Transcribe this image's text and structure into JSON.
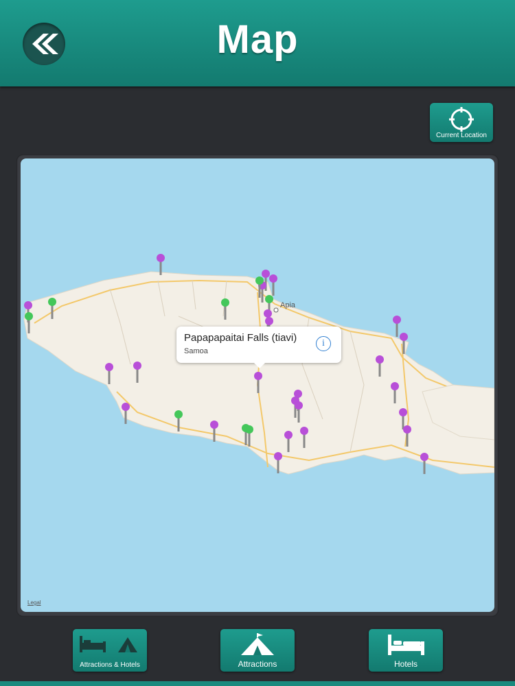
{
  "header": {
    "title": "Map",
    "back_icon": "double-chevron-left-icon"
  },
  "current_location": {
    "label": "Current Location",
    "icon": "crosshair-icon"
  },
  "map": {
    "legal": "Legal",
    "place_label": "Apia",
    "callout": {
      "title": "Papapapaitai Falls (tiavi)",
      "subtitle": "Samoa",
      "icon": "info-icon"
    },
    "pin_colors": {
      "attraction": "#b84fd8",
      "hotel": "#44c75a"
    },
    "water_color": "#a5d8ee",
    "land_color": "#f3efe6"
  },
  "tabs": [
    {
      "label": "Attractions & Hotels",
      "icon": "bed-and-tent-icon"
    },
    {
      "label": "Attractions",
      "icon": "tent-icon"
    },
    {
      "label": "Hotels",
      "icon": "bed-icon"
    }
  ],
  "colors": {
    "accent": "#1b8f83",
    "background": "#2b2d31"
  }
}
